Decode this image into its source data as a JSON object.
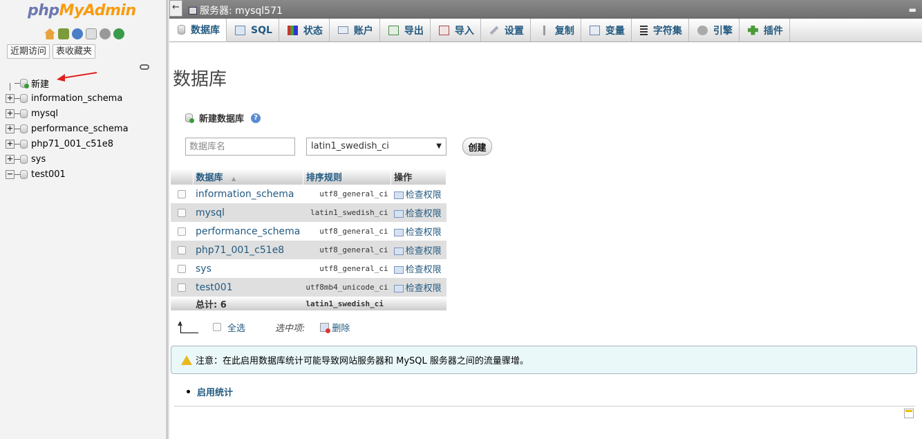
{
  "nav": {
    "logo_php": "php",
    "logo_myadmin": "MyAdmin",
    "tabs": [
      "近期访问",
      "表收藏夹"
    ],
    "tree": [
      {
        "label": "新建",
        "type": "new"
      },
      {
        "label": "information_schema",
        "type": "db"
      },
      {
        "label": "mysql",
        "type": "db"
      },
      {
        "label": "performance_schema",
        "type": "db"
      },
      {
        "label": "php71_001_c51e8",
        "type": "db"
      },
      {
        "label": "sys",
        "type": "db"
      },
      {
        "label": "test001",
        "type": "db-expanded"
      }
    ]
  },
  "topbar": {
    "back": "←",
    "server_label": "服务器: mysql571",
    "collapse": "▬"
  },
  "menu": {
    "tabs": [
      {
        "label": "数据库",
        "icon": "database-icon",
        "active": true
      },
      {
        "label": "SQL",
        "icon": "sql-icon"
      },
      {
        "label": "状态",
        "icon": "status-icon"
      },
      {
        "label": "账户",
        "icon": "accounts-icon"
      },
      {
        "label": "导出",
        "icon": "export-icon"
      },
      {
        "label": "导入",
        "icon": "import-icon"
      },
      {
        "label": "设置",
        "icon": "wrench-icon"
      },
      {
        "label": "复制",
        "icon": "replication-icon"
      },
      {
        "label": "变量",
        "icon": "variables-icon"
      },
      {
        "label": "字符集",
        "icon": "charset-icon"
      },
      {
        "label": "引擎",
        "icon": "engine-icon"
      },
      {
        "label": "插件",
        "icon": "plugin-icon"
      }
    ]
  },
  "main": {
    "title": "数据库",
    "create_label": "新建数据库",
    "db_name_placeholder": "数据库名",
    "collation_selected": "latin1_swedish_ci",
    "create_button": "创建"
  },
  "table": {
    "headers": {
      "name": "数据库",
      "collation": "排序规则",
      "action": "操作"
    },
    "rows": [
      {
        "name": "information_schema",
        "collation": "utf8_general_ci",
        "action": "检查权限"
      },
      {
        "name": "mysql",
        "collation": "latin1_swedish_ci",
        "action": "检查权限"
      },
      {
        "name": "performance_schema",
        "collation": "utf8_general_ci",
        "action": "检查权限"
      },
      {
        "name": "php71_001_c51e8",
        "collation": "utf8_general_ci",
        "action": "检查权限"
      },
      {
        "name": "sys",
        "collation": "utf8_general_ci",
        "action": "检查权限"
      },
      {
        "name": "test001",
        "collation": "utf8mb4_unicode_ci",
        "action": "检查权限"
      }
    ],
    "total_label": "总计: 6",
    "total_collation": "latin1_swedish_ci"
  },
  "bulk": {
    "select_all": "全选",
    "with_selected": "选中项:",
    "delete": "删除"
  },
  "notice": {
    "text": "注意：在此启用数据库统计可能导致网站服务器和 MySQL 服务器之间的流量骤增。"
  },
  "enable_stats": "启用统计",
  "colors": {
    "link": "#235a81",
    "logo_php": "#6c78af",
    "logo_myadmin": "#f89c0e",
    "notice_bg": "#ebf8fa",
    "even_row": "#dfdfdf"
  }
}
